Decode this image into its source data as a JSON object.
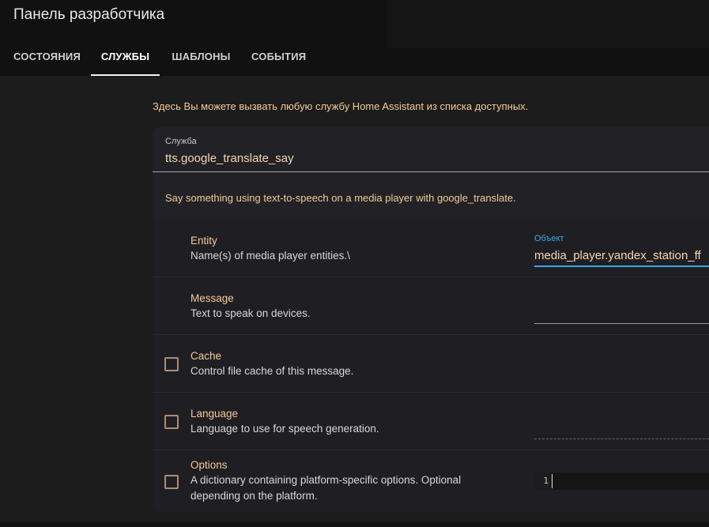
{
  "header": {
    "title": "Панель разработчика",
    "tabs": [
      {
        "label": "СОСТОЯНИЯ",
        "active": false
      },
      {
        "label": "СЛУЖБЫ",
        "active": true
      },
      {
        "label": "ШАБЛОНЫ",
        "active": false
      },
      {
        "label": "СОБЫТИЯ",
        "active": false
      }
    ]
  },
  "intro": "Здесь Вы можете вызвать любую службу Home Assistant из списка доступных.",
  "service": {
    "label": "Служба",
    "value": "tts.google_translate_say",
    "description": "Say something using text-to-speech on a media player with google_translate."
  },
  "fields": {
    "entity": {
      "name": "Entity",
      "description": "Name(s) of media player entities.\\",
      "input_label": "Объект",
      "input_value": "media_player.yandex_station_ff"
    },
    "message": {
      "name": "Message",
      "description": "Text to speak on devices.",
      "input_value": ""
    },
    "cache": {
      "name": "Cache",
      "description": "Control file cache of this message.",
      "checked": false
    },
    "language": {
      "name": "Language",
      "description": "Language to use for speech generation.",
      "checked": false
    },
    "options": {
      "name": "Options",
      "description_line1": "A dictionary containing platform-specific options. Optional",
      "description_line2": "depending on the platform.",
      "checked": false,
      "editor_line_number": "1"
    }
  },
  "colors": {
    "accent": "#3ea8e8",
    "field_name": "#f5c998",
    "background": "#111111",
    "card": "#222226"
  }
}
